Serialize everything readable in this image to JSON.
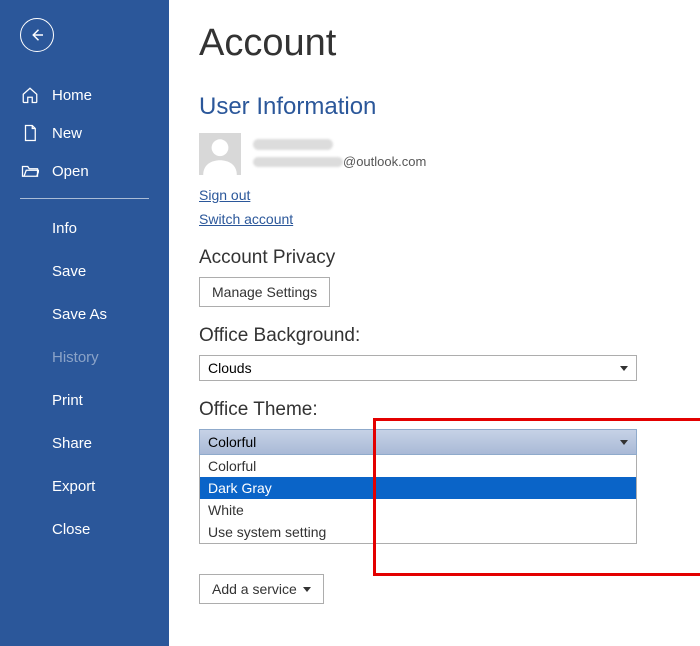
{
  "sidebar": {
    "topItems": [
      {
        "label": "Home"
      },
      {
        "label": "New"
      },
      {
        "label": "Open"
      }
    ],
    "bottomItems": [
      {
        "label": "Info"
      },
      {
        "label": "Save"
      },
      {
        "label": "Save As"
      },
      {
        "label": "History",
        "disabled": true
      },
      {
        "label": "Print"
      },
      {
        "label": "Share"
      },
      {
        "label": "Export"
      },
      {
        "label": "Close"
      }
    ]
  },
  "page": {
    "title": "Account",
    "userInfoHeading": "User Information",
    "emailSuffix": "@outlook.com",
    "signOut": "Sign out",
    "switchAccount": "Switch account",
    "privacyHeading": "Account Privacy",
    "manageSettings": "Manage Settings",
    "bgHeading": "Office Background:",
    "bgValue": "Clouds",
    "themeHeading": "Office Theme:",
    "themeValue": "Colorful",
    "themeOptions": [
      "Colorful",
      "Dark Gray",
      "White",
      "Use system setting"
    ],
    "themeHighlighted": "Dark Gray",
    "addService": "Add a service"
  }
}
